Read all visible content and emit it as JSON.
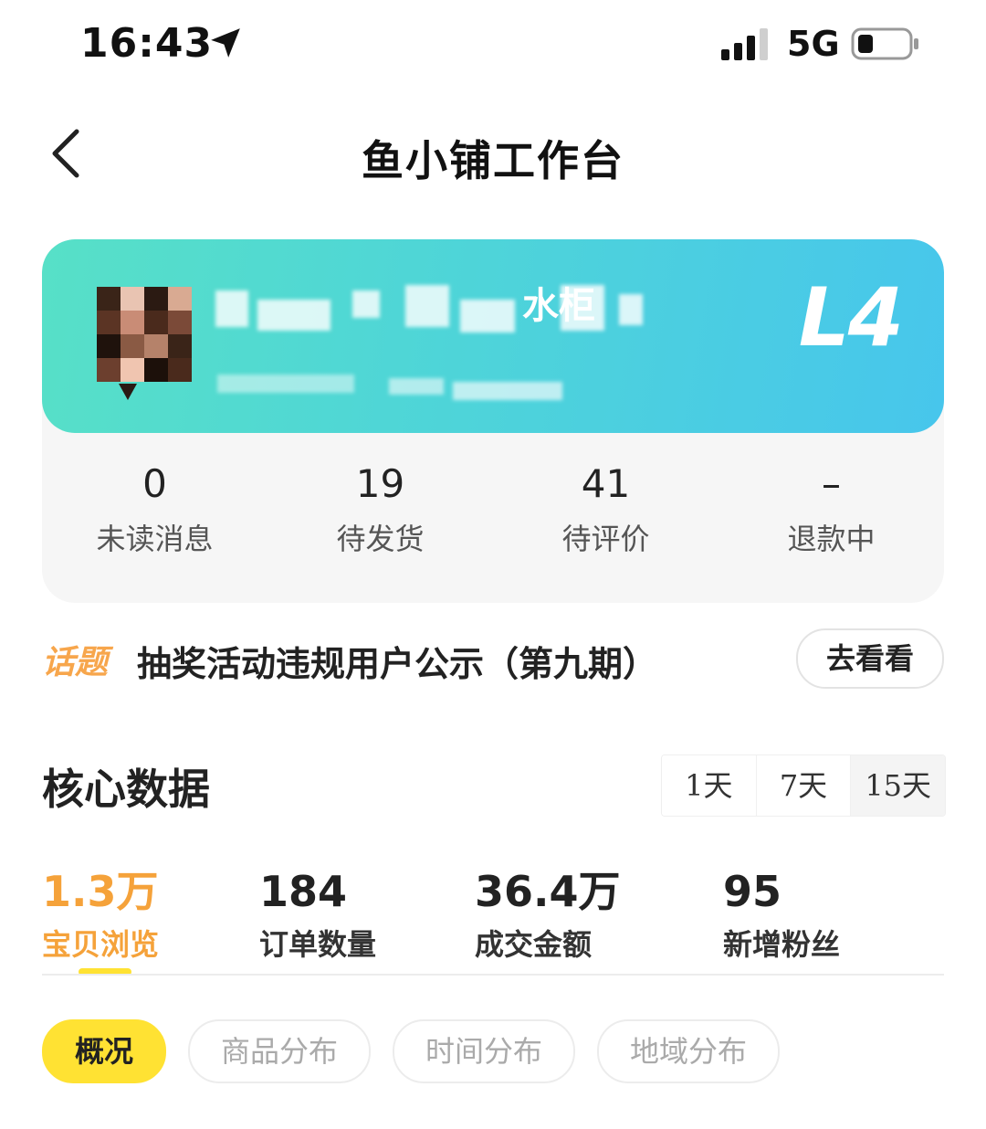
{
  "status_bar": {
    "time": "16:43",
    "network": "5G",
    "icons": [
      "location-arrow-icon",
      "signal-icon",
      "battery-icon"
    ]
  },
  "nav": {
    "title": "鱼小铺工作台",
    "back_icon": "chevron-left-icon"
  },
  "profile": {
    "name_visible": "水柜",
    "level": "L4",
    "banner_colors": [
      "#57e0c7",
      "#47c6ec"
    ]
  },
  "stats": [
    {
      "value": "0",
      "label": "未读消息"
    },
    {
      "value": "19",
      "label": "待发货"
    },
    {
      "value": "41",
      "label": "待评价"
    },
    {
      "value": "–",
      "label": "退款中"
    }
  ],
  "topic": {
    "tag": "话题",
    "text": "抽奖活动违规用户公示（第九期）",
    "button": "去看看"
  },
  "core_data": {
    "title": "核心数据",
    "ranges": [
      "1天",
      "7天",
      "15天"
    ],
    "active_range": "15天",
    "metrics": [
      {
        "value": "1.3万",
        "label": "宝贝浏览"
      },
      {
        "value": "184",
        "label": "订单数量"
      },
      {
        "value": "36.4万",
        "label": "成交金额"
      },
      {
        "value": "95",
        "label": "新增粉丝"
      }
    ],
    "active_metric": "宝贝浏览",
    "accent_color": "#f5a23a"
  },
  "tabs": {
    "items": [
      "概况",
      "商品分布",
      "时间分布",
      "地域分布"
    ],
    "active": "概况",
    "active_color": "#ffe233"
  }
}
